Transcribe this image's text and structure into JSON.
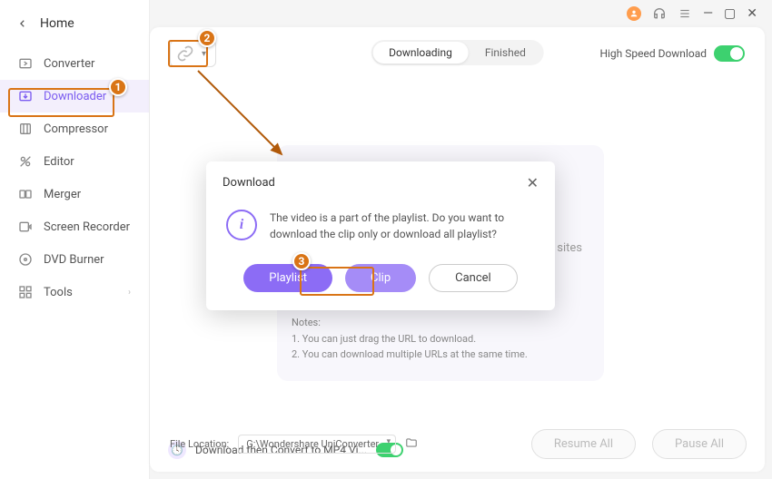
{
  "titlebar": {
    "minimize": "—",
    "maximize": "▢",
    "close": "✕"
  },
  "sidebar": {
    "home_label": "Home",
    "items": [
      {
        "label": "Converter"
      },
      {
        "label": "Downloader"
      },
      {
        "label": "Compressor"
      },
      {
        "label": "Editor"
      },
      {
        "label": "Merger"
      },
      {
        "label": "Screen Recorder"
      },
      {
        "label": "DVD Burner"
      },
      {
        "label": "Tools"
      }
    ]
  },
  "toolbar": {
    "tabs": {
      "downloading": "Downloading",
      "finished": "Finished"
    },
    "high_speed_label": "High Speed Download"
  },
  "dropzone": {
    "hint_suffix": "nd audio sites",
    "notes_title": "Notes:",
    "note1": "1. You can just drag the URL to download.",
    "note2": "2. You can download multiple URLs at the same time."
  },
  "dialog": {
    "title": "Download",
    "message": "The video is a part of the playlist. Do you want to download the clip only or download all playlist?",
    "playlist_btn": "Playlist",
    "clip_btn": "Clip",
    "cancel_btn": "Cancel"
  },
  "footer": {
    "convert_label": "Download then Convert to MP4 Vi...",
    "file_loc_label": "File Location:",
    "file_loc_value": "G:\\Wondershare UniConverter",
    "resume_btn": "Resume All",
    "pause_btn": "Pause All"
  },
  "annotations": {
    "m1": "1",
    "m2": "2",
    "m3": "3"
  }
}
